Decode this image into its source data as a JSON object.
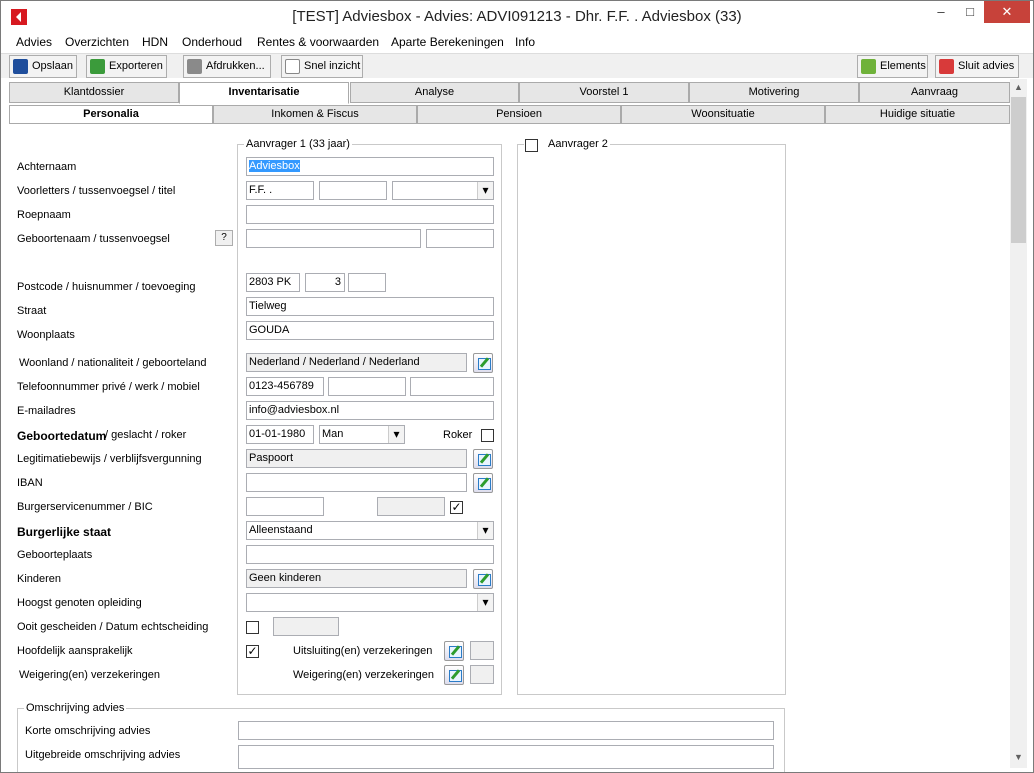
{
  "window": {
    "title": "[TEST] Adviesbox - Advies: ADVI091213 - Dhr. F.F. . Adviesbox (33)",
    "minimize": "–",
    "maximize": "□",
    "close": "✕"
  },
  "menu": [
    "Advies",
    "Overzichten",
    "HDN",
    "Onderhoud",
    "Rentes & voorwaarden",
    "Aparte Berekeningen",
    "Info"
  ],
  "toolbar": {
    "opslaan": "Opslaan",
    "exporteren": "Exporteren",
    "afdrukken": "Afdrukken...",
    "snel": "Snel inzicht",
    "elements": "Elements",
    "sluit": "Sluit advies"
  },
  "tabs1": [
    "Klantdossier",
    "Inventarisatie",
    "Analyse",
    "Voorstel 1",
    "Motivering",
    "Aanvraag"
  ],
  "tabs2": [
    "Personalia",
    "Inkomen & Fiscus",
    "Pensioen",
    "Woonsituatie",
    "Huidige situatie"
  ],
  "labels": {
    "achternaam": "Achternaam",
    "voorletters": "Voorletters / tussenvoegsel / titel",
    "roepnaam": "Roepnaam",
    "geboortenaam": "Geboortenaam / tussenvoegsel",
    "help": "?",
    "postcode": "Postcode / huisnummer / toevoeging",
    "straat": "Straat",
    "woonplaats": "Woonplaats",
    "woonland": "Woonland / nationaliteit / geboorteland",
    "telefoon": "Telefoonnummer privé / werk / mobiel",
    "email": "E-mailadres",
    "geboortedatum_b": "Geboortedatum",
    "geboortedatum_r": " / geslacht / roker",
    "roker": "Roker",
    "legitimatie": "Legitimatiebewijs / verblijfsvergunning",
    "iban": "IBAN",
    "bsn": "Burgerservicenummer / BIC",
    "burgerlijke": "Burgerlijke staat",
    "geboorteplaats": "Geboorteplaats",
    "kinderen": "Kinderen",
    "opleiding": "Hoogst genoten opleiding",
    "gescheiden": "Ooit gescheiden / Datum echtscheiding",
    "hoofdelijk": "Hoofdelijk aansprakelijk",
    "uitsluiting": "Uitsluiting(en) verzekeringen",
    "weigering": "Weigering(en) verzekeringen",
    "korte": "Korte omschrijving advies",
    "uitgebreide": "Uitgebreide omschrijving advies"
  },
  "groups": {
    "aanvrager1": "Aanvrager 1 (33 jaar)",
    "aanvrager2": "Aanvrager 2",
    "omschrijving": "Omschrijving advies"
  },
  "values": {
    "achternaam": "Adviesbox",
    "voorletters": "F.F. .",
    "postcode": "2803 PK",
    "huisnummer": "3",
    "straat": "Tielweg",
    "woonplaats": "GOUDA",
    "woonland": "Nederland / Nederland / Nederland",
    "telefoon": "0123-456789",
    "email": "info@adviesbox.nl",
    "geboortedatum": "01-01-1980",
    "geslacht": "Man",
    "legitimatie": "Paspoort",
    "burgerlijke": "Alleenstaand",
    "kinderen": "Geen kinderen"
  },
  "checks": {
    "bic": "✓",
    "hoofdelijk": "✓"
  },
  "scroll": {
    "up": "▲",
    "down": "▼"
  }
}
